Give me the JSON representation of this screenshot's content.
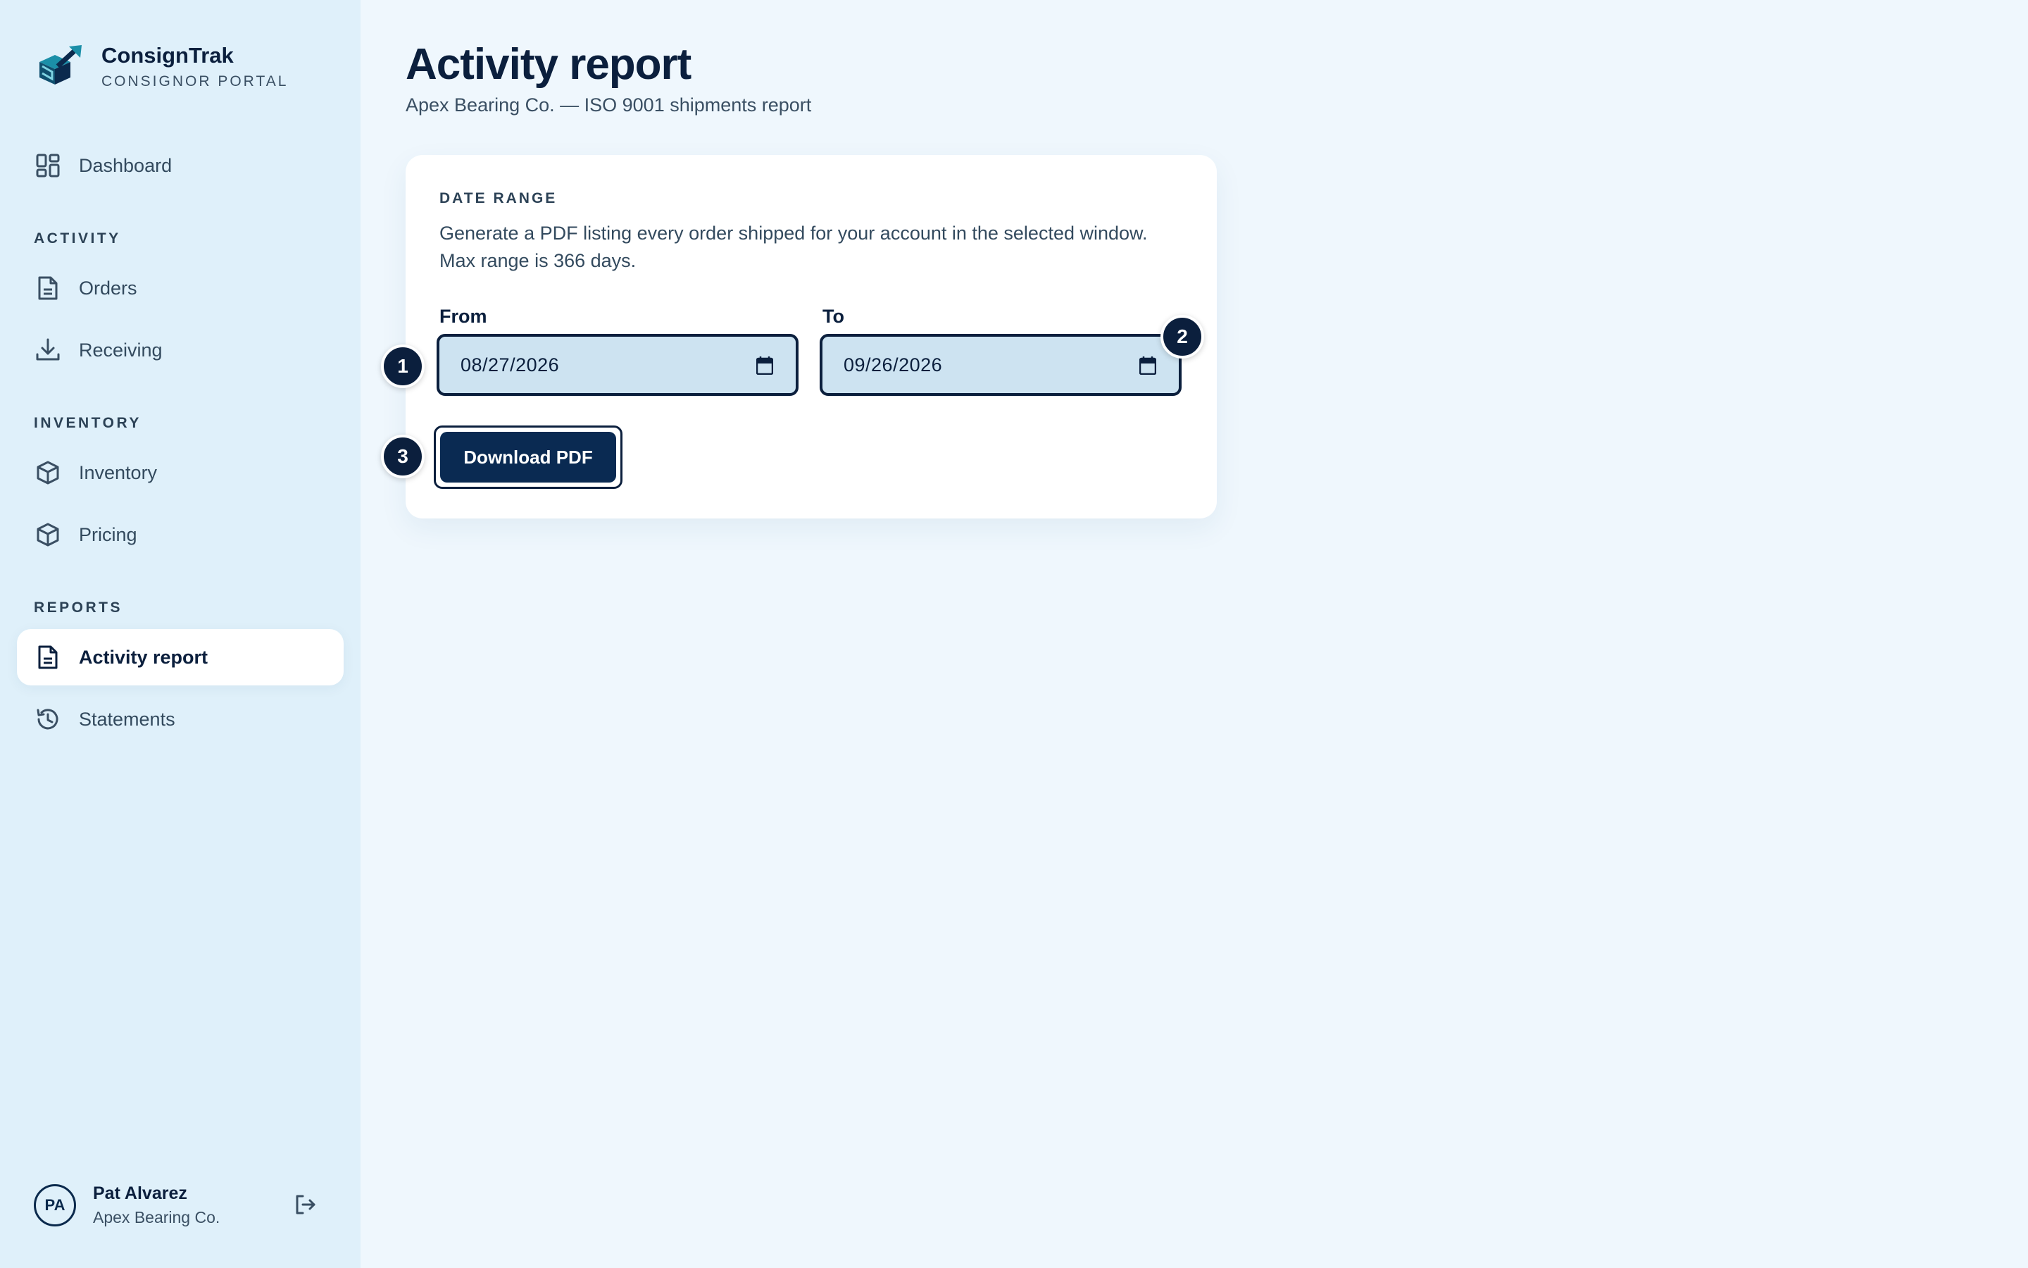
{
  "brand": {
    "name": "ConsignTrak",
    "subtitle": "CONSIGNOR PORTAL"
  },
  "sidebar": {
    "dashboard": {
      "label": "Dashboard",
      "icon": "dashboard-grid-icon"
    },
    "sections": [
      {
        "label": "ACTIVITY",
        "items": [
          {
            "label": "Orders",
            "icon": "document-icon"
          },
          {
            "label": "Receiving",
            "icon": "download-icon"
          }
        ]
      },
      {
        "label": "INVENTORY",
        "items": [
          {
            "label": "Inventory",
            "icon": "box-icon"
          },
          {
            "label": "Pricing",
            "icon": "box-icon"
          }
        ]
      },
      {
        "label": "REPORTS",
        "items": [
          {
            "label": "Activity report",
            "icon": "document-icon",
            "active": true
          },
          {
            "label": "Statements",
            "icon": "history-icon"
          }
        ]
      }
    ]
  },
  "user": {
    "initials": "PA",
    "name": "Pat Alvarez",
    "org": "Apex Bearing Co."
  },
  "page": {
    "title": "Activity report",
    "subtitle": "Apex Bearing Co. — ISO 9001 shipments report"
  },
  "card": {
    "label": "DATE RANGE",
    "description": "Generate a PDF listing every order shipped for your account in the selected window. Max range is 366 days.",
    "from_label": "From",
    "from_value": "08/27/2026",
    "to_label": "To",
    "to_value": "09/26/2026",
    "download_label": "Download PDF"
  },
  "steps": [
    "1",
    "2",
    "3"
  ],
  "colors": {
    "accent": "#0a2a52",
    "sidebar_bg": "#dff0fa",
    "page_bg": "#eff7fd",
    "field_bg": "#cde3f1"
  }
}
